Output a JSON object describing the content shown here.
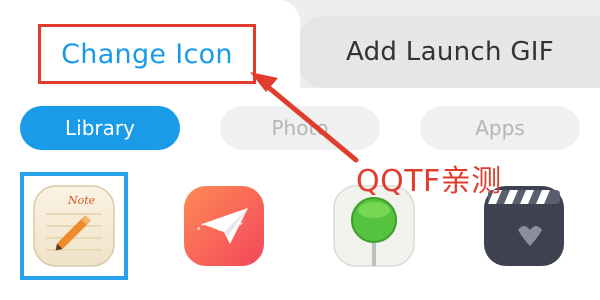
{
  "tabs": [
    {
      "label": "Change Icon"
    },
    {
      "label": "Add Launch GIF"
    }
  ],
  "segments": [
    {
      "label": "Library"
    },
    {
      "label": "Photo"
    },
    {
      "label": "Apps"
    }
  ],
  "icons": [
    {
      "icon": "note-pencil-icon",
      "label": "Note"
    },
    {
      "icon": "paper-plane-icon"
    },
    {
      "icon": "lollipop-icon"
    },
    {
      "icon": "clapperboard-icon"
    }
  ],
  "annotation": {
    "text": "QQTF亲测",
    "color": "#e03d2f"
  },
  "colors": {
    "accent": "#1a9be8",
    "annotation_red": "#e03d2f"
  }
}
